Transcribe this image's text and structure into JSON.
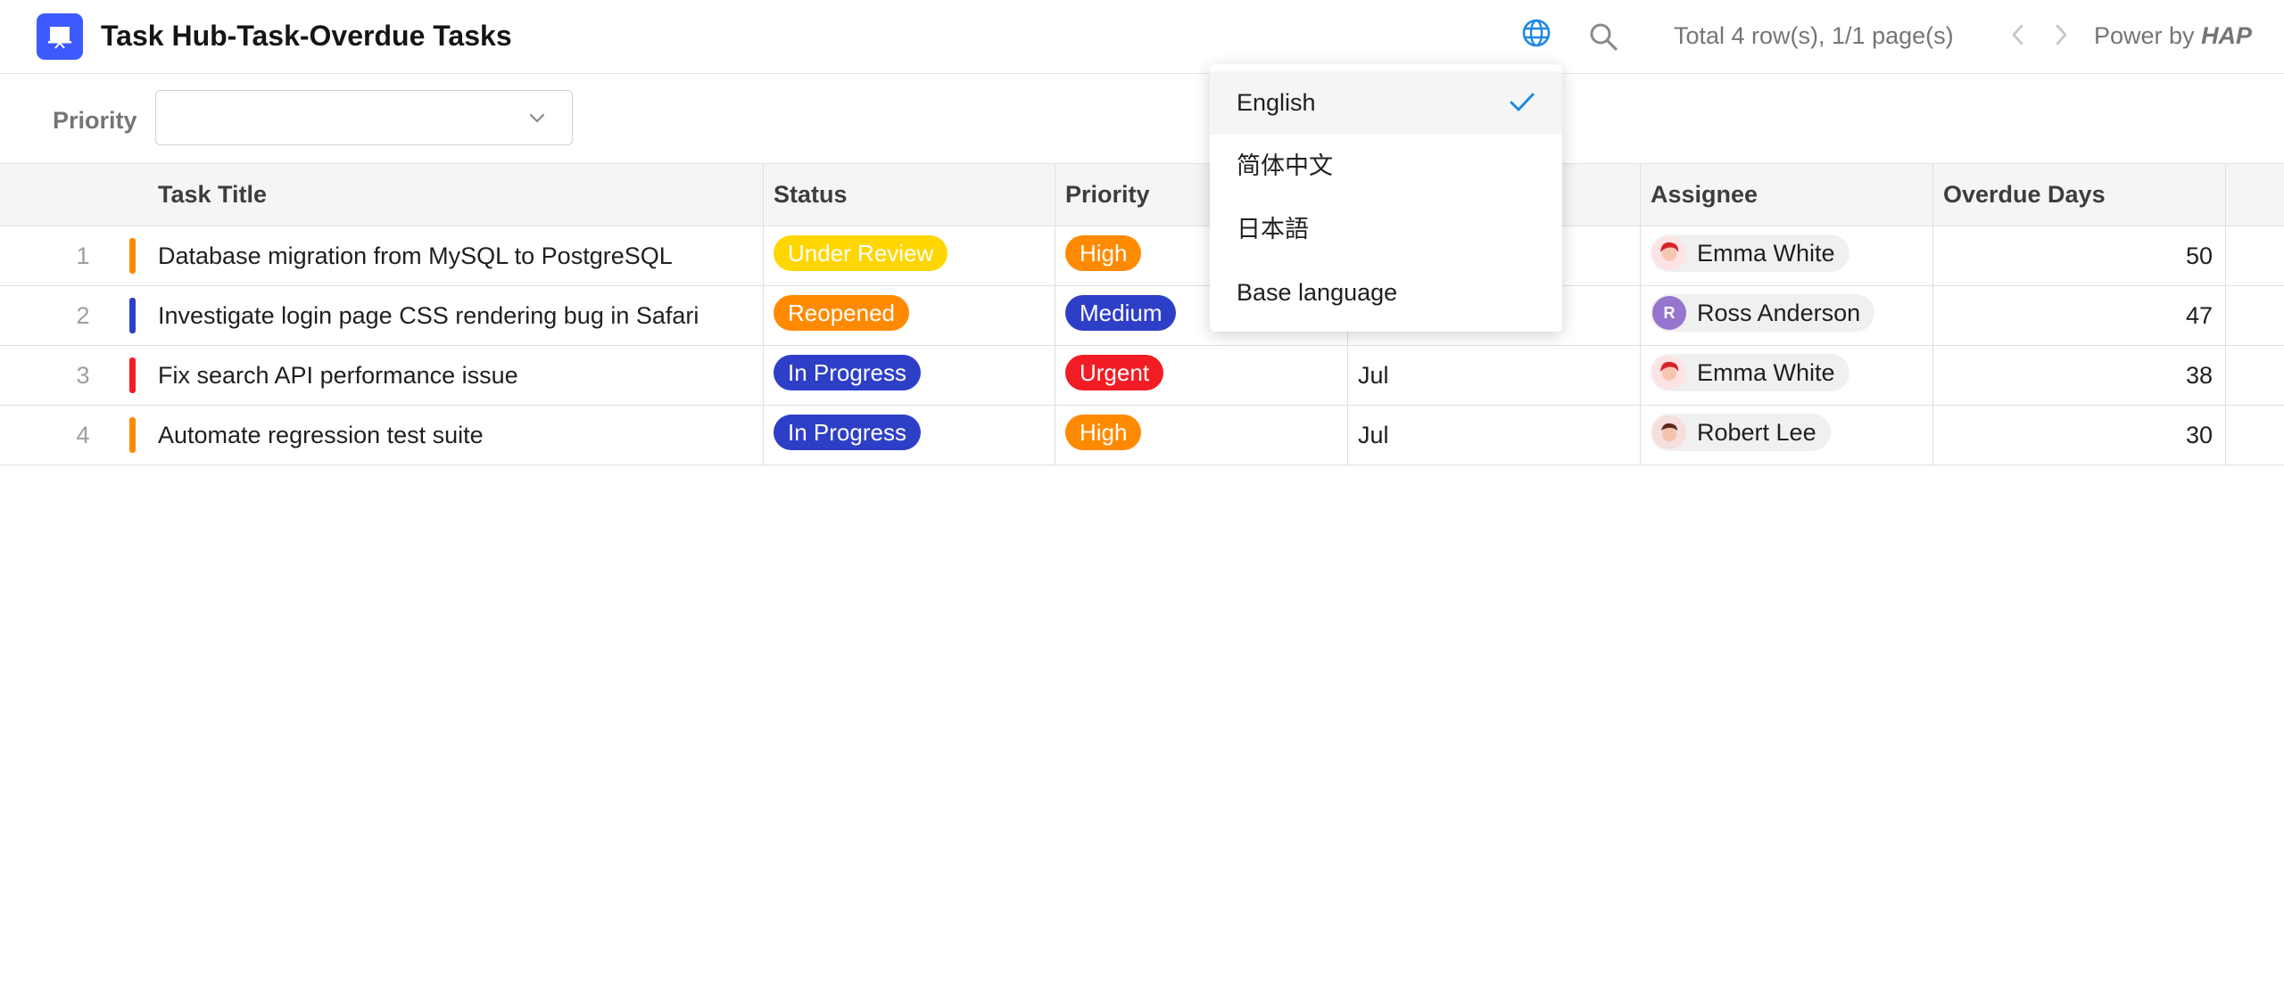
{
  "header": {
    "title": "Task Hub-Task-Overdue Tasks",
    "pager": "Total 4 row(s), 1/1 page(s)",
    "powered_prefix": "Power by ",
    "powered_brand": "HAP",
    "app_icon": "presentation-board-icon",
    "accent_color": "#3d5afe"
  },
  "filter": {
    "label": "Priority",
    "value": ""
  },
  "table": {
    "columns": [
      "Task Title",
      "Status",
      "Priority",
      "",
      "Assignee",
      "Overdue Days"
    ],
    "rows": [
      {
        "index": "1",
        "stripe": "#ff8a00",
        "title": "Database migration from MySQL to PostgreSQL",
        "status": "Under Review",
        "status_color": "#ffd600",
        "priority": "High",
        "priority_color": "#ff8a00",
        "date": "",
        "assignee": "Emma White",
        "avatar": "emma",
        "overdue": "50"
      },
      {
        "index": "2",
        "stripe": "#2e3fc7",
        "title": "Investigate login page CSS rendering bug in Safari",
        "status": "Reopened",
        "status_color": "#ff8a00",
        "priority": "Medium",
        "priority_color": "#2e3fc7",
        "date": "",
        "assignee": "Ross Anderson",
        "avatar": "R",
        "overdue": "47"
      },
      {
        "index": "3",
        "stripe": "#f21c24",
        "title": "Fix search API performance issue",
        "status": "In Progress",
        "status_color": "#2e3fc7",
        "priority": "Urgent",
        "priority_color": "#f21c24",
        "date": "Jul",
        "assignee": "Emma White",
        "avatar": "emma",
        "overdue": "38"
      },
      {
        "index": "4",
        "stripe": "#ff8a00",
        "title": "Automate regression test suite",
        "status": "In Progress",
        "status_color": "#2e3fc7",
        "priority": "High",
        "priority_color": "#ff8a00",
        "date": "Jul",
        "assignee": "Robert Lee",
        "avatar": "robert",
        "overdue": "30"
      }
    ]
  },
  "language_menu": {
    "items": [
      "English",
      "简体中文",
      "日本語",
      "Base language"
    ],
    "selected": "English"
  }
}
